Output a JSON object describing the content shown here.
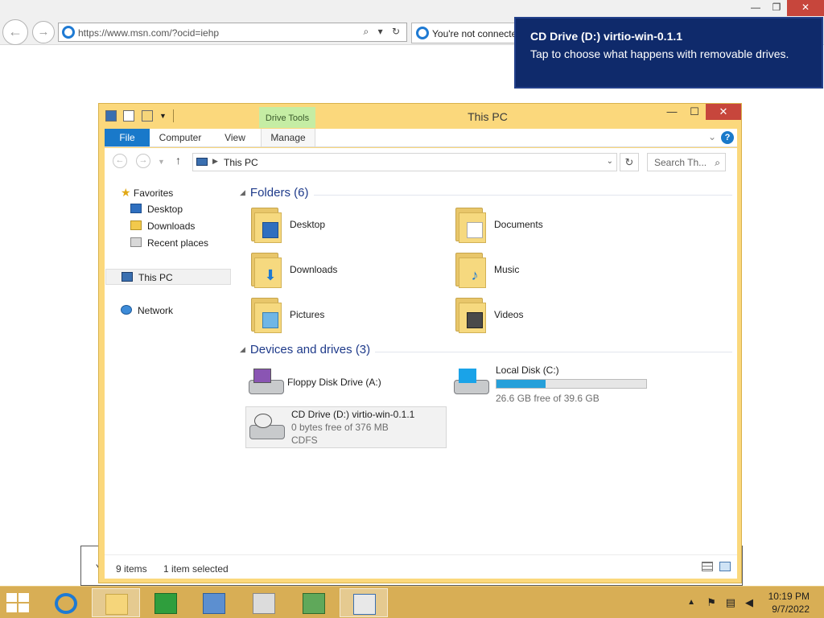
{
  "ie": {
    "url": "https://www.msn.com/?ocid=iehp",
    "addr_tools": "⌕ ▾ ↻",
    "tab_label": "You're not connected"
  },
  "toast": {
    "title": "CD Drive (D:) virtio-win-0.1.1",
    "body": "Tap to choose what happens with removable drives."
  },
  "window": {
    "title": "This PC",
    "contextual_tab": "Drive Tools"
  },
  "ribbon": {
    "tabs": [
      "File",
      "Computer",
      "View",
      "Manage"
    ]
  },
  "nav": {
    "address": "This PC",
    "search_placeholder": "Search Th..."
  },
  "nav_pane": {
    "favorites": "Favorites",
    "desktop": "Desktop",
    "downloads": "Downloads",
    "recent": "Recent places",
    "this_pc": "This PC",
    "network": "Network"
  },
  "groups": {
    "folders": "Folders (6)",
    "devices": "Devices and drives (3)"
  },
  "folders": [
    "Desktop",
    "Documents",
    "Downloads",
    "Music",
    "Pictures",
    "Videos"
  ],
  "drives": {
    "floppy": "Floppy Disk Drive (A:)",
    "local_c": {
      "name": "Local Disk (C:)",
      "free": "26.6 GB free of 39.6 GB",
      "used_fraction": 0.33
    },
    "cd": {
      "name": "CD Drive (D:) virtio-win-0.1.1",
      "free": "0 bytes free of 376 MB",
      "fs": "CDFS"
    }
  },
  "status": {
    "items": "9 items",
    "selected": "1 item selected"
  },
  "clock": {
    "time": "10:19 PM",
    "date": "9/7/2022"
  },
  "colors": {
    "window_frame": "#fbd87c",
    "ribbon_file": "#1979ca",
    "toast_bg": "#0f2a6b",
    "close_red": "#c7463c",
    "taskbar": "#d8ae55",
    "storage_bar": "#26a0da"
  }
}
